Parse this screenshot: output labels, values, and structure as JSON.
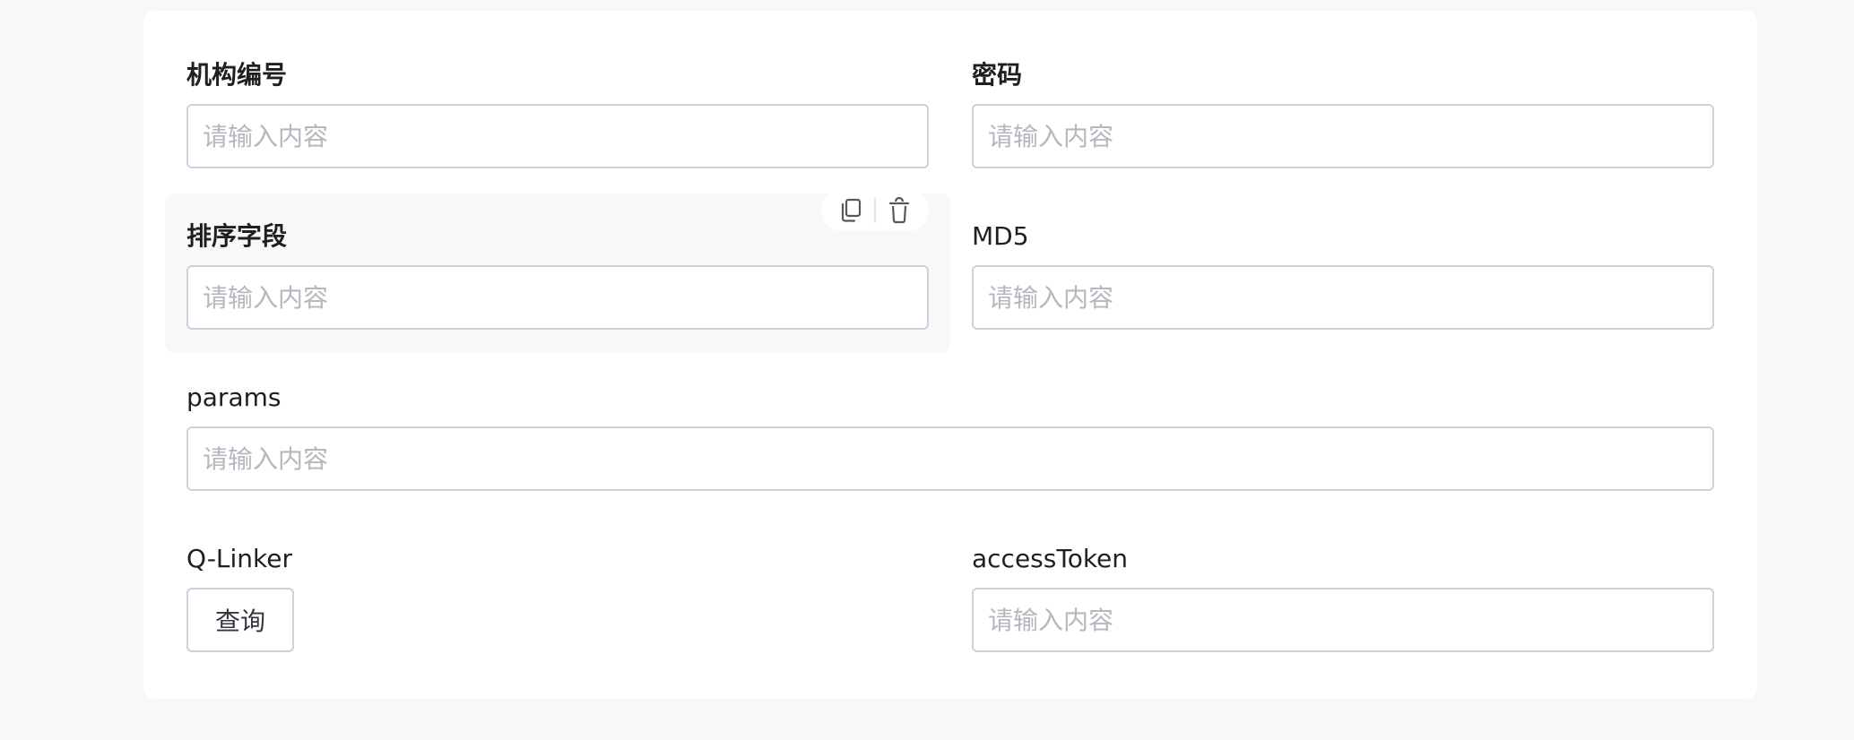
{
  "form": {
    "placeholder": "请输入内容",
    "fields": {
      "org_code": {
        "label": "机构编号",
        "value": ""
      },
      "password": {
        "label": "密码",
        "value": ""
      },
      "sort_field": {
        "label": "排序字段",
        "value": ""
      },
      "md5": {
        "label": "MD5",
        "value": ""
      },
      "params": {
        "label": "params",
        "value": ""
      },
      "q_linker": {
        "label": "Q-Linker",
        "button_label": "查询"
      },
      "access_token": {
        "label": "accessToken",
        "value": ""
      }
    }
  },
  "toolbar": {
    "icons": [
      "copy-icon",
      "trash-icon"
    ]
  },
  "colors": {
    "border": "#cdd0dc",
    "placeholder": "#b5b7bf",
    "card_bg": "#ffffff",
    "page_bg": "#f7f8fa",
    "highlight_bg": "#f8f8f9"
  }
}
